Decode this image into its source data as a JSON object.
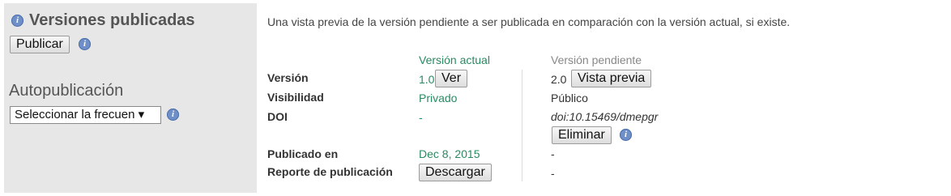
{
  "sidebar": {
    "title": "Versiones publicadas",
    "publish_button": "Publicar",
    "autopublish_label": "Autopublicación",
    "frequency_select": "Seleccionar la frecuen ▾"
  },
  "main": {
    "description": "Una vista previa de la versión pendiente a ser publicada en comparación con la versión actual, si existe.",
    "col_current": "Versión actual",
    "col_pending": "Versión pendiente",
    "rows": {
      "version": {
        "label": "Versión",
        "current": "1.0",
        "current_button": "Ver",
        "pending": "2.0",
        "pending_button": "Vista previa"
      },
      "visibility": {
        "label": "Visibilidad",
        "current": "Privado",
        "pending": "Público"
      },
      "doi": {
        "label": "DOI",
        "current": "-",
        "pending": "doi:10.15469/dmepgr",
        "pending_button": "Eliminar"
      },
      "published": {
        "label": "Publicado en",
        "current": "Dec 8, 2015",
        "pending": "-"
      },
      "report": {
        "label": "Reporte de publicación",
        "current_button": "Descargar",
        "pending": "-"
      }
    }
  },
  "icons": {
    "info": "i"
  },
  "colors": {
    "accent_green": "#2a8a62",
    "info_blue": "#6f8fc9",
    "sidebar_bg": "#e7e7e7"
  }
}
